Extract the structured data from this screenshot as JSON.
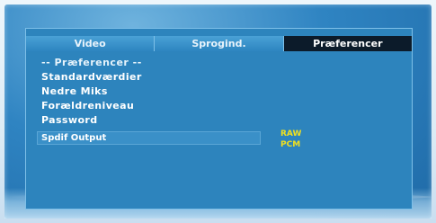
{
  "tabs": [
    {
      "label": "Video",
      "active": false
    },
    {
      "label": "Sprogind.",
      "active": false
    },
    {
      "label": "Præferencer",
      "active": true
    }
  ],
  "section_title": "-- Præferencer --",
  "menu_items": [
    {
      "label": "Standardværdier"
    },
    {
      "label": "Nedre Miks"
    },
    {
      "label": "Forældreniveau"
    },
    {
      "label": "Password"
    }
  ],
  "spdif": {
    "label": "Spdif Output",
    "options": [
      "RAW",
      "PCM"
    ]
  },
  "colors": {
    "panel": "#2d84bd",
    "active_tab": "#0c1b2a",
    "option_text": "#f0e020"
  }
}
